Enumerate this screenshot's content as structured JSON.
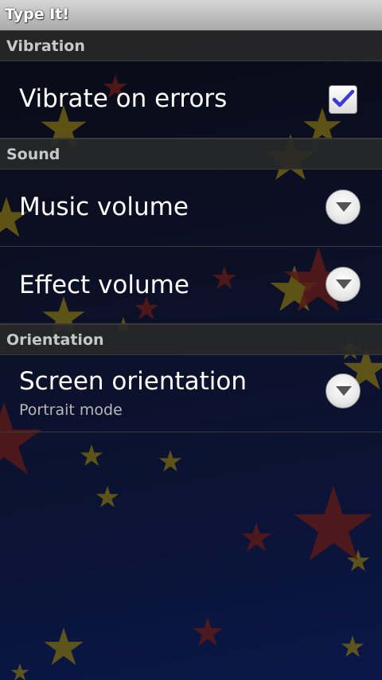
{
  "app": {
    "title": "Type It!"
  },
  "sections": {
    "vibration": {
      "header": "Vibration",
      "vibrate_on_errors": {
        "title": "Vibrate on errors",
        "checked": true
      }
    },
    "sound": {
      "header": "Sound",
      "music_volume": {
        "title": "Music volume"
      },
      "effect_volume": {
        "title": "Effect volume"
      }
    },
    "orientation": {
      "header": "Orientation",
      "screen_orientation": {
        "title": "Screen orientation",
        "summary": "Portrait mode"
      }
    }
  },
  "colors": {
    "checkmark": "#3b3bd9",
    "star_gold": "#7a6a12",
    "star_red": "#5a1a18"
  },
  "icons": {
    "checkbox": "checkmark-icon",
    "dropdown": "chevron-down-icon"
  }
}
